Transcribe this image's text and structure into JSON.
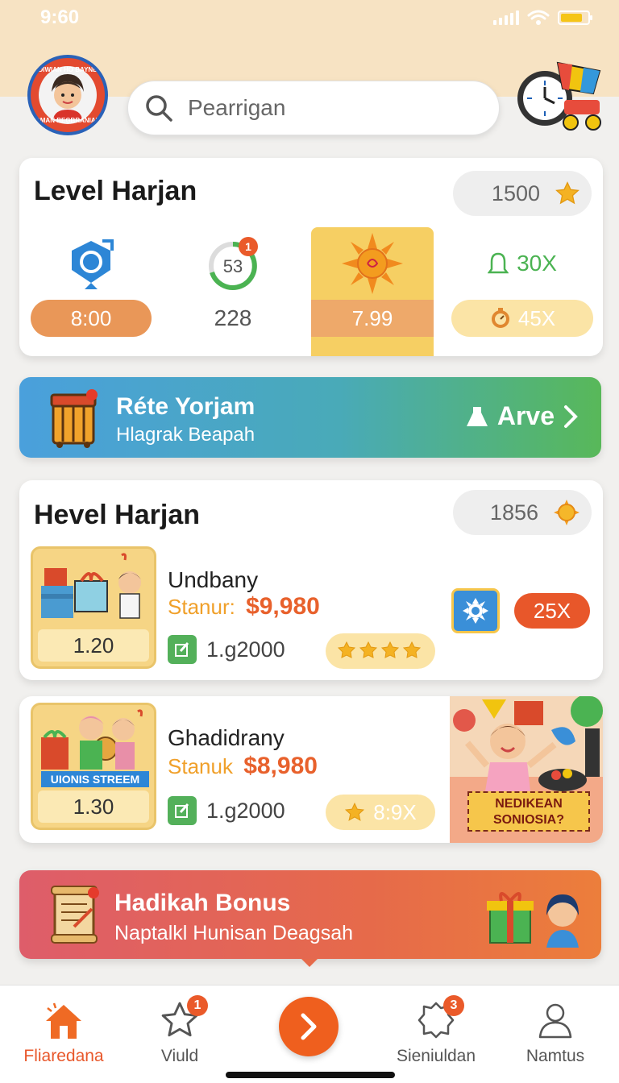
{
  "status": {
    "time": "9:60"
  },
  "search": {
    "placeholder": "Pearrigan"
  },
  "avatar": {
    "ring_top": "DIWIAN HO BAYNE",
    "ring_bottom": "GMAN BEGBRANIAU"
  },
  "level_card": {
    "title": "Level Harjan",
    "score": "1500",
    "stats": [
      {
        "value": "8:00",
        "icon": "hexagon-gear-icon"
      },
      {
        "value": "228",
        "ring_value": "53",
        "badge": "1",
        "icon": "progress-ring-icon"
      },
      {
        "value": "7.99",
        "icon": "sun-icon"
      },
      {
        "top_value": "30X",
        "value": "45X",
        "icon": "bell-icon"
      }
    ]
  },
  "promo": {
    "title": "Réte Yorjam",
    "subtitle": "Hlagrak Beapah",
    "action": "Arve"
  },
  "shop_card": {
    "title": "Hevel Harjan",
    "score": "1856",
    "item": {
      "name": "Undbany",
      "price_label": "Stanur:",
      "price": "$9,980",
      "thumb_label": "1.20",
      "meta": "1.g2000",
      "multiplier": "25X"
    }
  },
  "item2": {
    "name": "Ghadidrany",
    "price_label": "Stanuk",
    "price": "$8,980",
    "thumb_label": "1.30",
    "thumb_banner": "UIONIS STREEM",
    "meta": "1.g2000",
    "rating": "8:9X",
    "promo_banner": "NEDIKEAN SONIOSIA?"
  },
  "bonus": {
    "title": "Hadikah Bonus",
    "subtitle": "Naptalkl Hunisan Deagsah"
  },
  "nav": {
    "items": [
      {
        "label": "Fliaredana",
        "icon": "home-icon"
      },
      {
        "label": "Viuld",
        "icon": "star-icon",
        "badge": "1"
      },
      {
        "label": "Sieniuldan",
        "icon": "badge-icon",
        "badge": "3"
      },
      {
        "label": "Namtus",
        "icon": "user-icon"
      }
    ]
  },
  "colors": {
    "accent": "#e8572a",
    "gold": "#f6cf63",
    "promo_blue": "#4aa0dc",
    "promo_green": "#58b859",
    "bonus_red": "#de5d6a"
  }
}
